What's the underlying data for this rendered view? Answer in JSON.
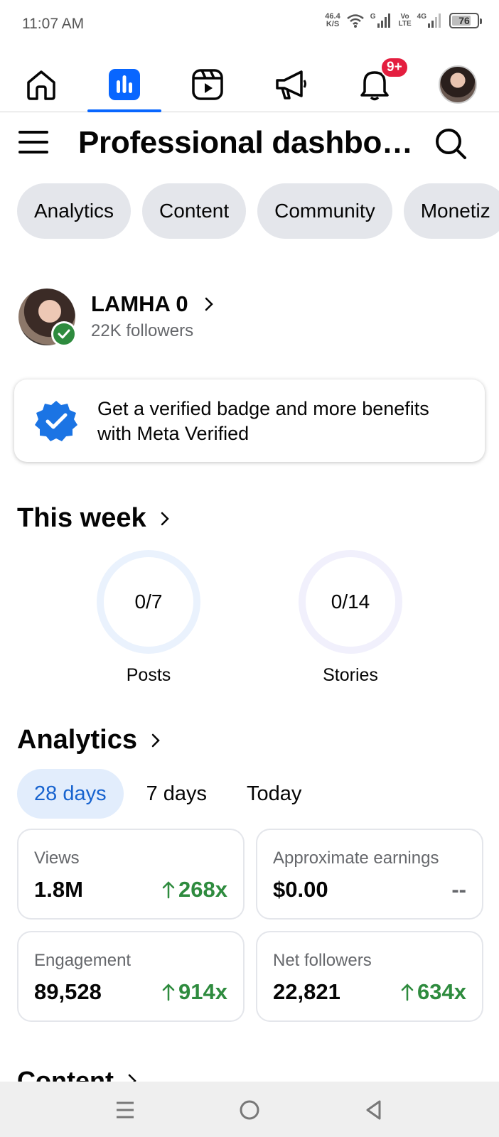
{
  "status_bar": {
    "time": "11:07 AM",
    "net_speed_value": "46.4",
    "net_speed_unit": "K/S",
    "sim1_label": "G",
    "volte_top": "Vo",
    "volte_bottom": "LTE",
    "sim2_label": "4G",
    "battery": "76",
    "battery_level": 0.76
  },
  "top_nav": {
    "items": [
      {
        "icon": "home-icon"
      },
      {
        "icon": "dashboard-icon",
        "active": true
      },
      {
        "icon": "reels-icon"
      },
      {
        "icon": "megaphone-icon"
      },
      {
        "icon": "bell-icon",
        "badge": "9+"
      },
      {
        "icon": "profile-avatar"
      }
    ]
  },
  "header": {
    "title": "Professional dashbo…"
  },
  "chips": [
    "Analytics",
    "Content",
    "Community",
    "Monetiz"
  ],
  "profile": {
    "name": "LAMHA 0",
    "followers": "22K followers"
  },
  "verified_card": {
    "text": "Get a verified badge and more benefits with Meta Verified"
  },
  "this_week": {
    "title": "This week",
    "posts": {
      "value": "0/7",
      "label": "Posts"
    },
    "stories": {
      "value": "0/14",
      "label": "Stories"
    }
  },
  "analytics": {
    "title": "Analytics",
    "ranges": [
      "28 days",
      "7 days",
      "Today"
    ],
    "active_range": "28 days",
    "metrics": [
      {
        "label": "Views",
        "value": "1.8M",
        "change": "268x",
        "trend": "up"
      },
      {
        "label": "Approximate earnings",
        "value": "$0.00",
        "change": "--",
        "trend": "none"
      },
      {
        "label": "Engagement",
        "value": "89,528",
        "change": "914x",
        "trend": "up"
      },
      {
        "label": "Net followers",
        "value": "22,821",
        "change": "634x",
        "trend": "up"
      }
    ]
  },
  "content_section": {
    "title": "Content"
  },
  "colors": {
    "accent": "#0866ff",
    "positive": "#2e8b3e",
    "badge": "#e41e3f",
    "chip_bg": "#e4e6eb"
  }
}
